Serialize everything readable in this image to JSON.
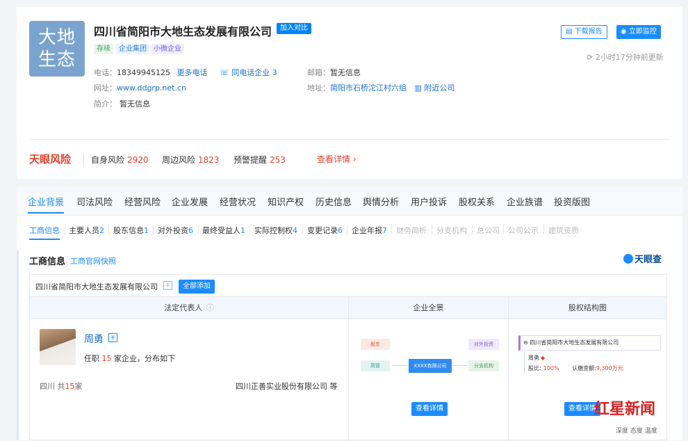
{
  "company": {
    "logo_text_line1": "大地",
    "logo_text_line2": "生态",
    "name": "四川省简阳市大地生态发展有限公司",
    "compare_label": "加入对比",
    "tags": [
      "存续",
      "企业集团",
      "小微企业"
    ],
    "phone_label": "电话：",
    "phone": "18349945125",
    "more_phones": "更多电话",
    "same_phone": "同电话企业 3",
    "email_label": "邮箱：",
    "email": "暂无信息",
    "website_label": "网址：",
    "website": "www.ddgrp.net.cn",
    "address_label": "地址：",
    "address": "简阳市石桥沱江村六组",
    "nearby": "附近公司",
    "intro_label": "简介：",
    "intro": "暂无信息",
    "download_report": "下载报告",
    "monitor_now": "立即监控",
    "update_time": "2小时17分钟前更新"
  },
  "risk": {
    "logo": "天眼风险",
    "self_label": "自身风险",
    "self_count": "2920",
    "around_label": "周边风险",
    "around_count": "1823",
    "warn_label": "预警提醒",
    "warn_count": "253",
    "more": "查看详情 ›"
  },
  "main_tabs": [
    "企业背景",
    "司法风险",
    "经营风险",
    "企业发展",
    "经营状况",
    "知识产权",
    "历史信息",
    "舆情分析",
    "用户投诉",
    "股权关系",
    "企业族谱",
    "投资版图"
  ],
  "sub_tabs": [
    {
      "label": "工商信息",
      "count": ""
    },
    {
      "label": "主要人员",
      "count": "2"
    },
    {
      "label": "股东信息",
      "count": "1"
    },
    {
      "label": "对外投资",
      "count": "6"
    },
    {
      "label": "最终受益人",
      "count": "1"
    },
    {
      "label": "实际控制权",
      "count": "4"
    },
    {
      "label": "变更记录",
      "count": "6"
    },
    {
      "label": "企业年报",
      "count": "7"
    },
    {
      "label": "财务简析",
      "count": ""
    },
    {
      "label": "分支机构",
      "count": ""
    },
    {
      "label": "总公司",
      "count": ""
    },
    {
      "label": "公司公示",
      "count": ""
    },
    {
      "label": "建筑资质",
      "count": ""
    }
  ],
  "section": {
    "title": "工商信息",
    "snapshot_link": "工商官网快照",
    "brand": "天眼查",
    "company_name": "四川省简阳市大地生态发展有限公司",
    "add_all": "全部添加",
    "col_legal": "法定代表人",
    "col_panorama": "企业全景",
    "col_equity": "股权结构图"
  },
  "legal_rep": {
    "name": "周勇",
    "desc_pre": "任职 ",
    "desc_count": "15",
    "desc_post": " 家企业，分布如下",
    "region_pre": "四川  共",
    "region_count": "15",
    "region_post": "家",
    "company": "四川正善实业股份有限公司 等"
  },
  "panorama": {
    "shareholder": "股东",
    "executive": "高管",
    "center": "XXXX有限公司",
    "investment": "对外投资",
    "branch": "分支机构",
    "view": "查看详情"
  },
  "equity": {
    "company": "四川省简阳市大地生态发展有限公司",
    "person": "周勇",
    "ratio_label": "股比:",
    "ratio": "100%",
    "capital_label": "认缴金额:",
    "capital": "9,300万元",
    "view": "查看详情"
  },
  "watermark": {
    "text": "红星新闻",
    "sub": "深度 态度 温度"
  }
}
